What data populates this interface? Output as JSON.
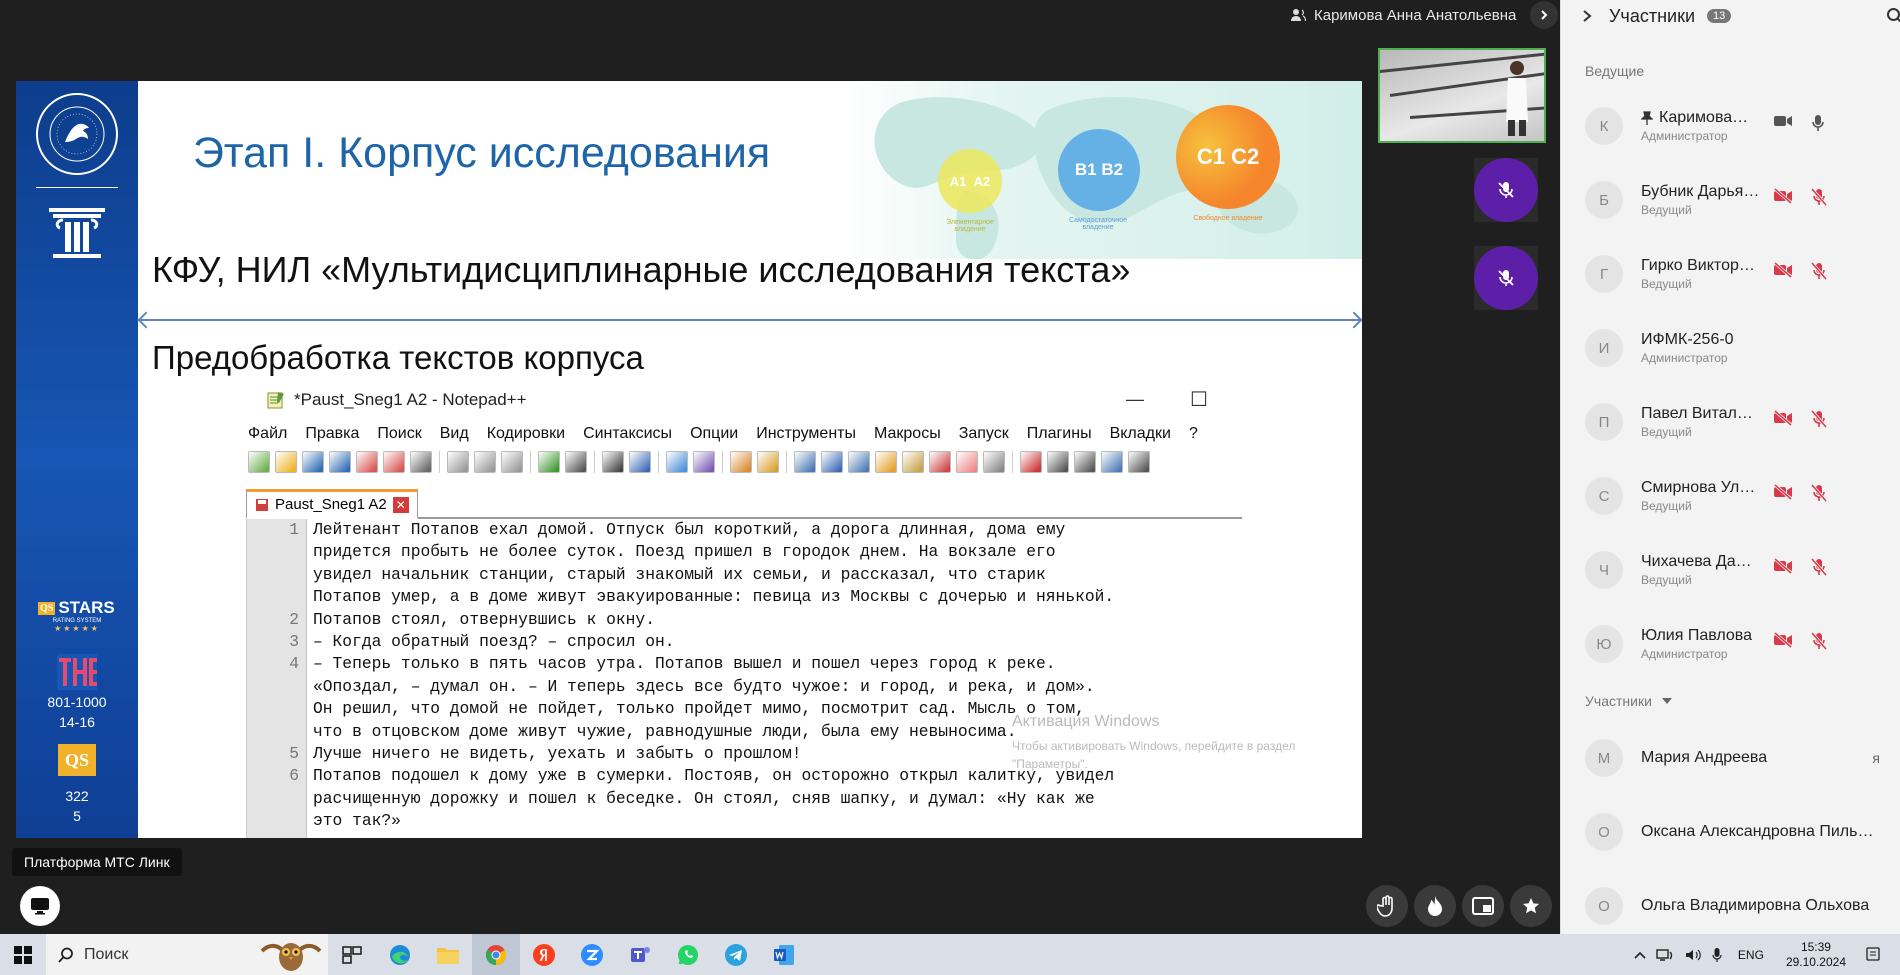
{
  "presenter": {
    "name": "Каримова Анна Анатольевна"
  },
  "slide": {
    "title": "Этап I. Корпус исследования",
    "subtitle1": "КФУ,  НИЛ «Мультидисциплинарные исследования текста»",
    "subtitle2": "Предобработка текстов корпуса",
    "levels": [
      {
        "a": "A1",
        "b": "A2",
        "caption": "Элементарное владение"
      },
      {
        "a": "B1",
        "b": "B2",
        "caption": "Самодостаточное владение"
      },
      {
        "a": "C1",
        "b": "C2",
        "caption": "Свободное владение"
      }
    ],
    "left": {
      "qs_stars": "STARS",
      "qs_stars_sub": "RATING SYSTEM",
      "the_rank": "801-1000",
      "the_sub": "14-16",
      "qs_logo": "QS",
      "qs_rank": "322",
      "qs_sub": "5"
    }
  },
  "notepad": {
    "title": "*Paust_Sneg1 A2 - Notepad++",
    "menu": [
      "Файл",
      "Правка",
      "Поиск",
      "Вид",
      "Кодировки",
      "Синтаксисы",
      "Опции",
      "Инструменты",
      "Макросы",
      "Запуск",
      "Плагины",
      "Вкладки",
      "?"
    ],
    "tab": "Paust_Sneg1 A2",
    "lines": [
      {
        "n": "1",
        "text": "Лейтенант Потапов ехал домой. Отпуск был короткий, а дорога длинная, дома ему"
      },
      {
        "n": "",
        "text": "придется пробыть не более суток. Поезд пришел в городок днем. На вокзале его"
      },
      {
        "n": "",
        "text": "увидел начальник станции, старый знакомый их семьи, и рассказал, что старик"
      },
      {
        "n": "",
        "text": "Потапов умер, а в доме живут эвакуированные: певица из Москвы с дочерью и нянькой."
      },
      {
        "n": "2",
        "text": "Потапов стоял, отвернувшись к окну."
      },
      {
        "n": "3",
        "text": "– Когда обратный поезд? – спросил он."
      },
      {
        "n": "4",
        "text": "– Теперь только в пять часов утра. Потапов вышел и пошел через город к реке."
      },
      {
        "n": "",
        "text": "«Опоздал, – думал он. – И теперь здесь все будто чужое: и город, и река, и дом»."
      },
      {
        "n": "",
        "text": "Он решил, что домой не пойдет, только пройдет мимо, посмотрит сад. Мысль о том,"
      },
      {
        "n": "",
        "text": "что в отцовском доме живут чужие, равнодушные люди, была ему невыносима."
      },
      {
        "n": "5",
        "text": "Лучше ничего не видеть, уехать и забыть о прошлом!"
      },
      {
        "n": "6",
        "text": "Потапов подошел к дому уже в сумерки. Постояв, он осторожно открыл калитку, увидел"
      },
      {
        "n": "",
        "text": "расчищенную дорожку и пошел к беседке. Он стоял, сняв шапку, и думал: «Ну как же"
      },
      {
        "n": "",
        "text": "это так?»"
      }
    ]
  },
  "activation": {
    "title": "Активация Windows",
    "text": "Чтобы активировать Windows, перейдите в раздел \"Параметры\"."
  },
  "platform_label": "Платформа МТС Линк",
  "panel": {
    "title": "Участники",
    "count": "13",
    "hosts_label": "Ведущие",
    "participants_label": "Участники",
    "hosts": [
      {
        "initial": "К",
        "name": "Каримова…",
        "role": "Администратор",
        "pinned": true,
        "cam_on": true,
        "mic_on": true
      },
      {
        "initial": "Б",
        "name": "Бубник Дарья…",
        "role": "Ведущий",
        "pinned": false,
        "cam_on": false,
        "mic_on": false
      },
      {
        "initial": "Г",
        "name": "Гирко Виктор…",
        "role": "Ведущий",
        "pinned": false,
        "cam_on": false,
        "mic_on": false
      },
      {
        "initial": "И",
        "name": "ИФМК-256-0",
        "role": "Администратор",
        "pinned": false,
        "cam_on": null,
        "mic_on": null
      },
      {
        "initial": "П",
        "name": "Павел Витал…",
        "role": "Ведущий",
        "pinned": false,
        "cam_on": false,
        "mic_on": false
      },
      {
        "initial": "С",
        "name": "Смирнова Ул…",
        "role": "Ведущий",
        "pinned": false,
        "cam_on": false,
        "mic_on": false
      },
      {
        "initial": "Ч",
        "name": "Чихачева Да…",
        "role": "Ведущий",
        "pinned": false,
        "cam_on": false,
        "mic_on": false
      },
      {
        "initial": "Ю",
        "name": "Юлия Павлова",
        "role": "Администратор",
        "pinned": false,
        "cam_on": false,
        "mic_on": false
      }
    ],
    "participants": [
      {
        "initial": "М",
        "name": "Мария Андреева",
        "extra": "я"
      },
      {
        "initial": "О",
        "name": "Оксана Александровна Пиль…",
        "extra": ""
      },
      {
        "initial": "О",
        "name": "Ольга Владимировна Ольхова",
        "extra": ""
      }
    ]
  },
  "taskbar": {
    "search_placeholder": "Поиск",
    "lang": "ENG",
    "time": "15:39",
    "date": "29.10.2024"
  },
  "colors": {
    "mic_off": "#d93a4a",
    "accent_purple": "#5e1fa8",
    "slide_title": "#1d64a8"
  }
}
